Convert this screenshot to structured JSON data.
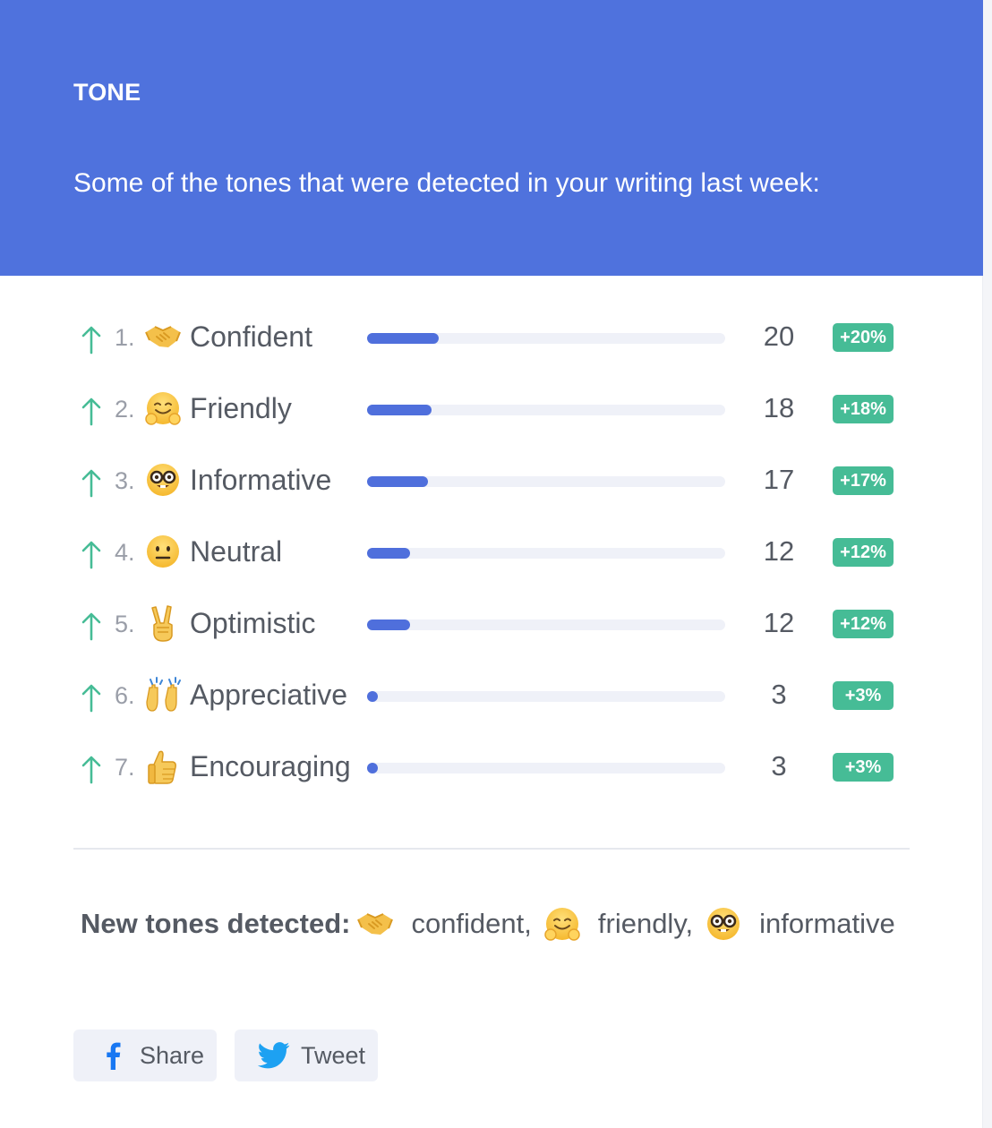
{
  "header": {
    "kicker": "TONE",
    "subtitle": "Some of the tones that were detected in your writing last week:",
    "background": "#4f72dd"
  },
  "tones": [
    {
      "rank": "1.",
      "emoji": "handshake-icon",
      "label": "Confident",
      "count": "20",
      "change": "+20%",
      "bar_fraction": 0.2
    },
    {
      "rank": "2.",
      "emoji": "hugging-face-icon",
      "label": "Friendly",
      "count": "18",
      "change": "+18%",
      "bar_fraction": 0.18
    },
    {
      "rank": "3.",
      "emoji": "nerd-face-icon",
      "label": "Informative",
      "count": "17",
      "change": "+17%",
      "bar_fraction": 0.17
    },
    {
      "rank": "4.",
      "emoji": "neutral-face-icon",
      "label": "Neutral",
      "count": "12",
      "change": "+12%",
      "bar_fraction": 0.12
    },
    {
      "rank": "5.",
      "emoji": "victory-hand-icon",
      "label": "Optimistic",
      "count": "12",
      "change": "+12%",
      "bar_fraction": 0.12
    },
    {
      "rank": "6.",
      "emoji": "raised-hands-icon",
      "label": "Appreciative",
      "count": "3",
      "change": "+3%",
      "bar_fraction": 0.03
    },
    {
      "rank": "7.",
      "emoji": "thumbs-up-icon",
      "label": "Encouraging",
      "count": "3",
      "change": "+3%",
      "bar_fraction": 0.03
    }
  ],
  "new_tones": {
    "title": "New tones detected:",
    "items": [
      {
        "emoji": "handshake-icon",
        "text": "confident,"
      },
      {
        "emoji": "hugging-face-icon",
        "text": "friendly,"
      },
      {
        "emoji": "nerd-face-icon",
        "text": "informative"
      }
    ]
  },
  "buttons": {
    "share_label": "Share",
    "tweet_label": "Tweet"
  },
  "colors": {
    "accent": "#4f6fdc",
    "up_arrow": "#46bc96",
    "badge": "#46bc96",
    "facebook": "#1877f2",
    "twitter": "#1da1f2"
  }
}
